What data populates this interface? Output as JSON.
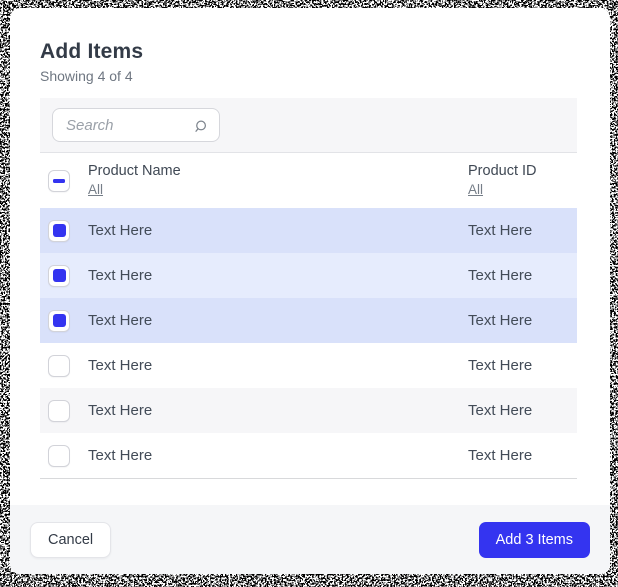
{
  "modal": {
    "title": "Add Items",
    "subtitle": "Showing 4 of 4"
  },
  "search": {
    "placeholder": "Search",
    "icon": "magnifier-icon"
  },
  "table": {
    "columns": [
      {
        "label": "Product Name",
        "filter": "All"
      },
      {
        "label": "Product ID",
        "filter": "All"
      }
    ],
    "header_checkbox_state": "indeterminate",
    "rows": [
      {
        "name": "Text Here",
        "id": "Text Here",
        "selected": true
      },
      {
        "name": "Text Here",
        "id": "Text Here",
        "selected": true
      },
      {
        "name": "Text Here",
        "id": "Text Here",
        "selected": true
      },
      {
        "name": "Text Here",
        "id": "Text Here",
        "selected": false
      },
      {
        "name": "Text Here",
        "id": "Text Here",
        "selected": false
      },
      {
        "name": "Text Here",
        "id": "Text Here",
        "selected": false
      }
    ],
    "selected_count": 3
  },
  "footer": {
    "cancel_label": "Cancel",
    "submit_label": "Add 3 Items"
  },
  "colors": {
    "accent": "#3434f0",
    "selected_row_odd": "#d9e1fa",
    "selected_row_even": "#e6ecfd",
    "unselected_row_odd": "#f6f6f8",
    "search_strip_bg": "#f6f6f8",
    "footer_bg": "#f5f6f8"
  }
}
